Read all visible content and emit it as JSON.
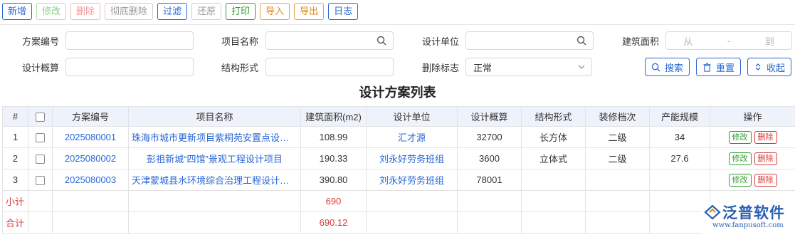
{
  "toolbar": {
    "add": "新增",
    "edit": "修改",
    "delete": "删除",
    "purge": "彻底删除",
    "filter": "过滤",
    "restore": "还原",
    "print": "打印",
    "import": "导入",
    "export": "导出",
    "log": "日志"
  },
  "filters": {
    "scheme_no_label": "方案编号",
    "project_name_label": "项目名称",
    "design_unit_label": "设计单位",
    "area_label": "建筑面积",
    "area_from": "从",
    "area_sep": "-",
    "area_to": "到",
    "estimate_label": "设计概算",
    "structure_label": "结构形式",
    "delete_flag_label": "删除标志",
    "delete_flag_value": "正常",
    "search_btn": "搜索",
    "reset_btn": "重置",
    "collapse_btn": "收起"
  },
  "title": "设计方案列表",
  "table": {
    "headers": [
      "#",
      "",
      "方案编号",
      "项目名称",
      "建筑面积(m2)",
      "设计单位",
      "设计概算",
      "结构形式",
      "装修档次",
      "产能规模",
      "操作"
    ],
    "rows": [
      {
        "idx": "1",
        "no": "2025080001",
        "name": "珠海市城市更新项目紫桐苑安置点设计项目",
        "area": "108.99",
        "unit": "汇才源",
        "estimate": "32700",
        "structure": "长方体",
        "decor": "二级",
        "capacity": "34"
      },
      {
        "idx": "2",
        "no": "2025080002",
        "name": "彭祖新城“四馆”景观工程设计项目",
        "area": "190.33",
        "unit": "刘永好劳务班组",
        "estimate": "3600",
        "structure": "立体式",
        "decor": "二级",
        "capacity": "27.6"
      },
      {
        "idx": "3",
        "no": "2025080003",
        "name": "天津蒙城县水环境综合治理工程设计项目",
        "area": "390.80",
        "unit": "刘永好劳务班组",
        "estimate": "78001",
        "structure": "",
        "decor": "",
        "capacity": ""
      }
    ],
    "op_edit": "修改",
    "op_delete": "删除",
    "subtotal_label": "小计",
    "subtotal_area": "690",
    "total_label": "合计",
    "total_area": "690.12"
  },
  "logo": {
    "name": "泛普软件",
    "url": "www.fanpusoft.com"
  },
  "colors": {
    "accent": "#2867d6",
    "success": "#2e9d2e",
    "danger": "#d83a3a",
    "warning": "#e08a1e",
    "header_bg": "#eef3fb"
  }
}
